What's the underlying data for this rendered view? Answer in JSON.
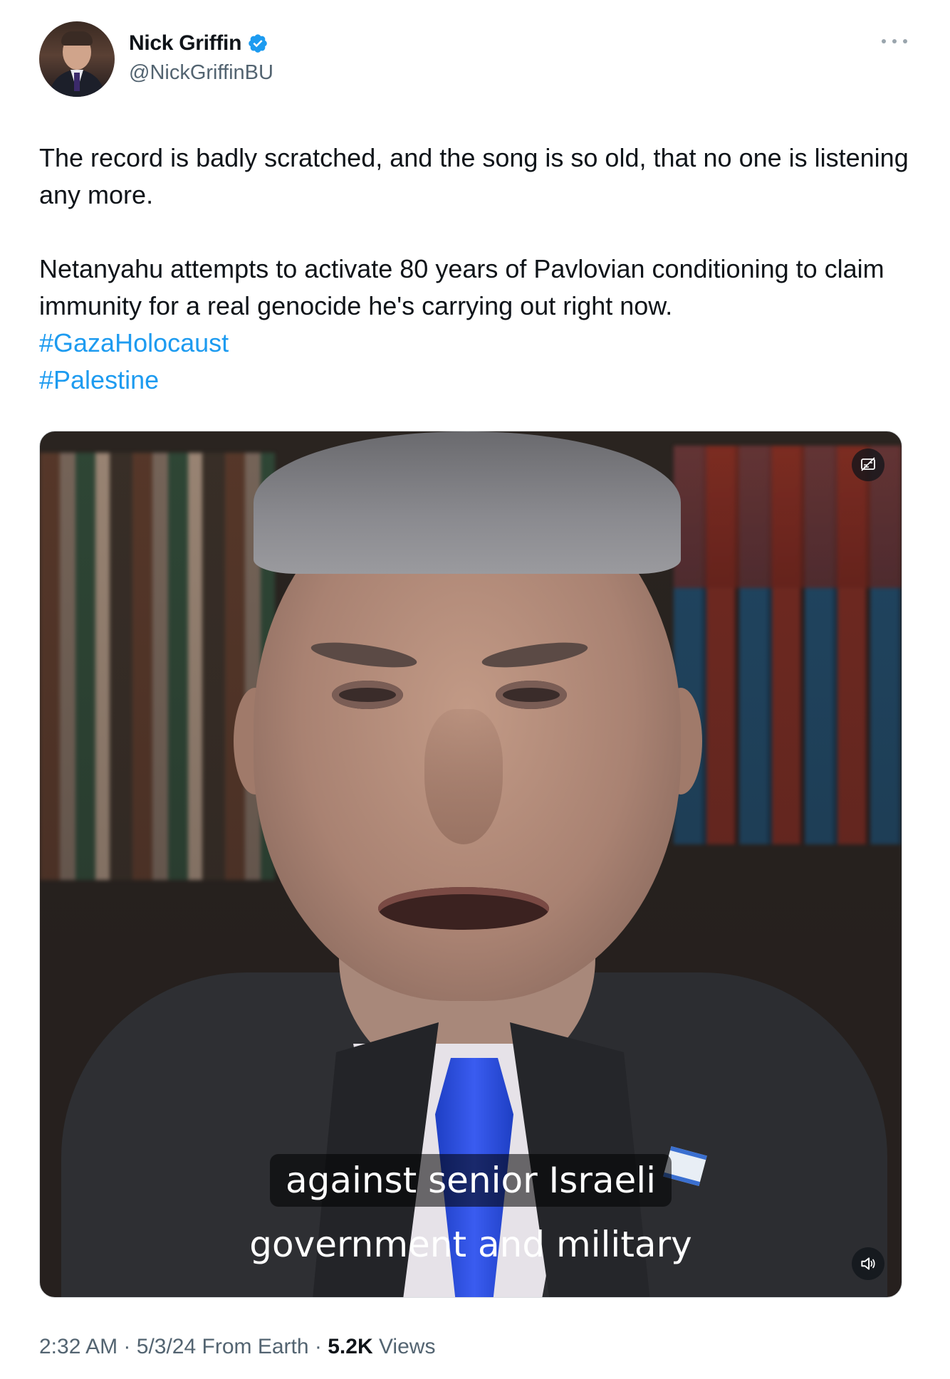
{
  "author": {
    "name": "Nick Griffin",
    "handle": "@NickGriffinBU",
    "verified_color": "#1d9bf0"
  },
  "tweet": {
    "paragraph1": "The record is badly scratched, and the song is so old, that no one is listening any more.",
    "paragraph2": "Netanyahu attempts to activate 80 years of Pavlovian conditioning to claim immunity for a real genocide he's carrying out right now.",
    "hashtags": [
      "#GazaHolocaust",
      "#Palestine"
    ],
    "hashtag_color": "#1d9bf0"
  },
  "media": {
    "caption_line1": "against senior Israeli",
    "caption_line2": "government and military",
    "content_icon": "content-disclosure-icon",
    "sound_icon": "speaker-icon"
  },
  "meta": {
    "time": "2:32 AM",
    "date": "5/3/24",
    "source": "From Earth",
    "views_count": "5.2K",
    "views_label": "Views",
    "separator": "·"
  }
}
